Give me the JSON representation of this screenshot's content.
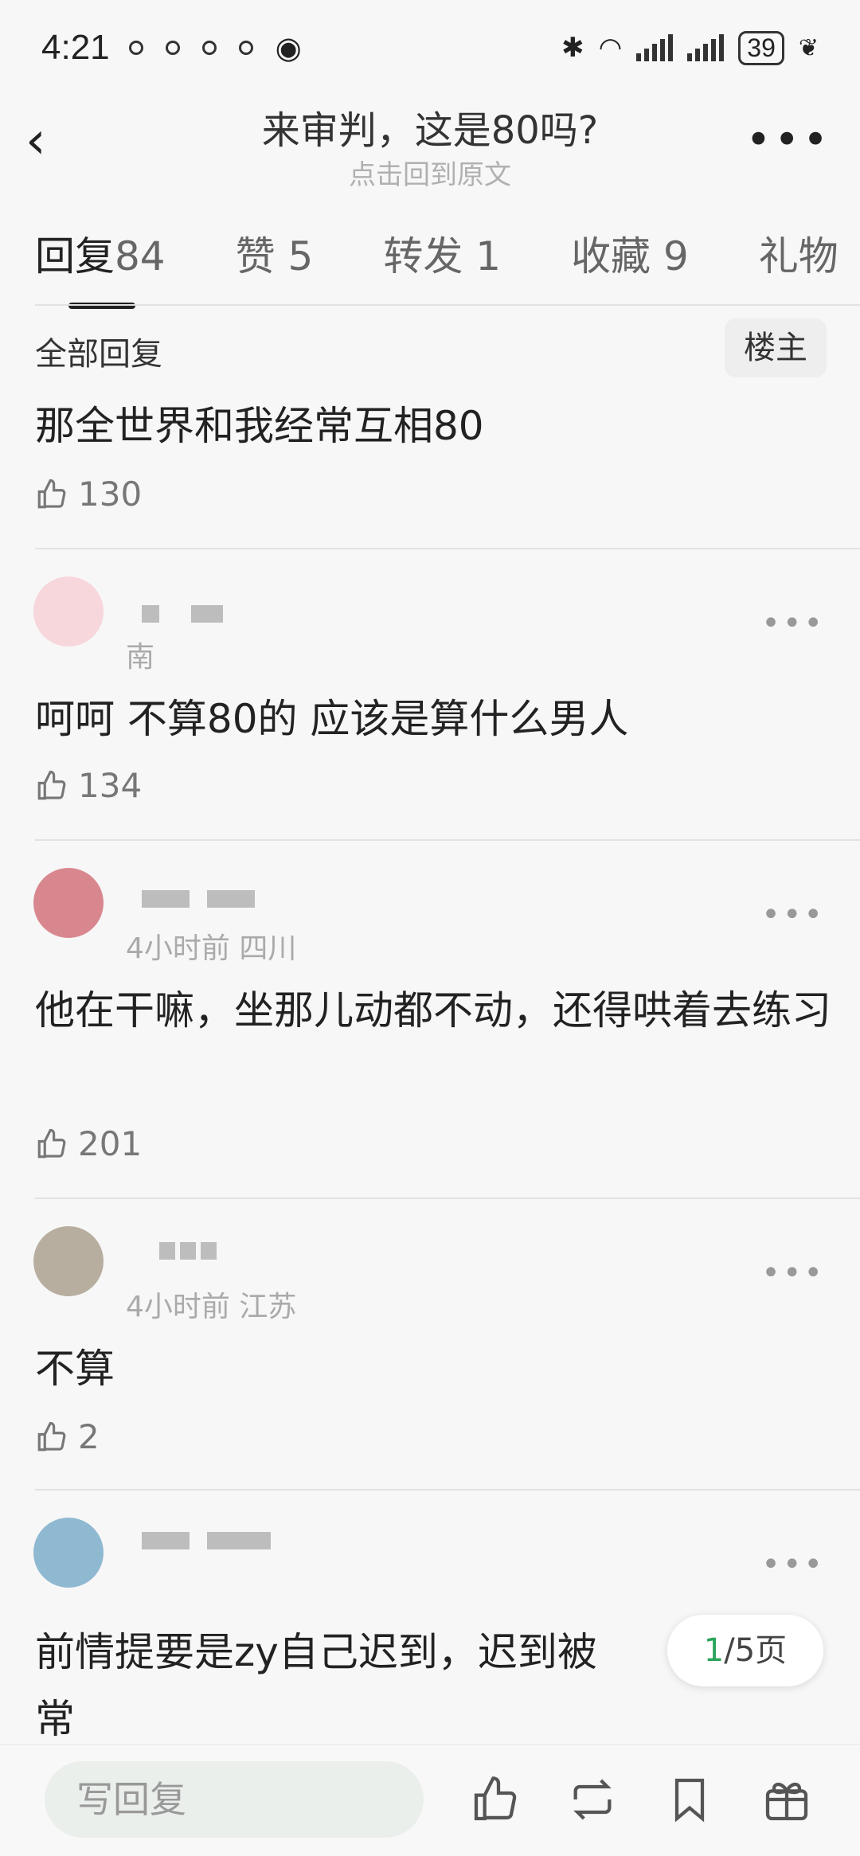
{
  "status": {
    "time": "4:21",
    "battery": "39"
  },
  "header": {
    "back": "‹",
    "title": "来审判，这是80吗?",
    "subtitle": "点击回到原文",
    "more": "•••"
  },
  "tabs": [
    {
      "label": "回复",
      "count": "84"
    },
    {
      "label": "赞",
      "count": "5"
    },
    {
      "label": "转发",
      "count": "1"
    },
    {
      "label": "收藏",
      "count": "9"
    },
    {
      "label": "礼物",
      "count": ""
    }
  ],
  "section": {
    "all_replies": "全部回复",
    "filter": "楼主"
  },
  "comments": [
    {
      "meta": "",
      "text": "那全世界和我经常互相80",
      "likes": "130"
    },
    {
      "meta": "南",
      "text": "呵呵 不算80的 应该是算什么男人",
      "likes": "134"
    },
    {
      "meta": "4小时前 四川",
      "text": "他在干嘛，坐那儿动都不动，还得哄着去练习",
      "likes": "201"
    },
    {
      "meta": "4小时前 江苏",
      "text": "不算",
      "likes": "2"
    },
    {
      "meta": "",
      "text": "前情提要是zy自己迟到，迟到被",
      "text2": "常",
      "likes": ""
    }
  ],
  "pager": {
    "current": "1",
    "total": "/5页"
  },
  "bottom": {
    "reply_placeholder": "写回复"
  },
  "colors": {
    "accent": "#2aa45a",
    "background": "#f7f7f7"
  }
}
